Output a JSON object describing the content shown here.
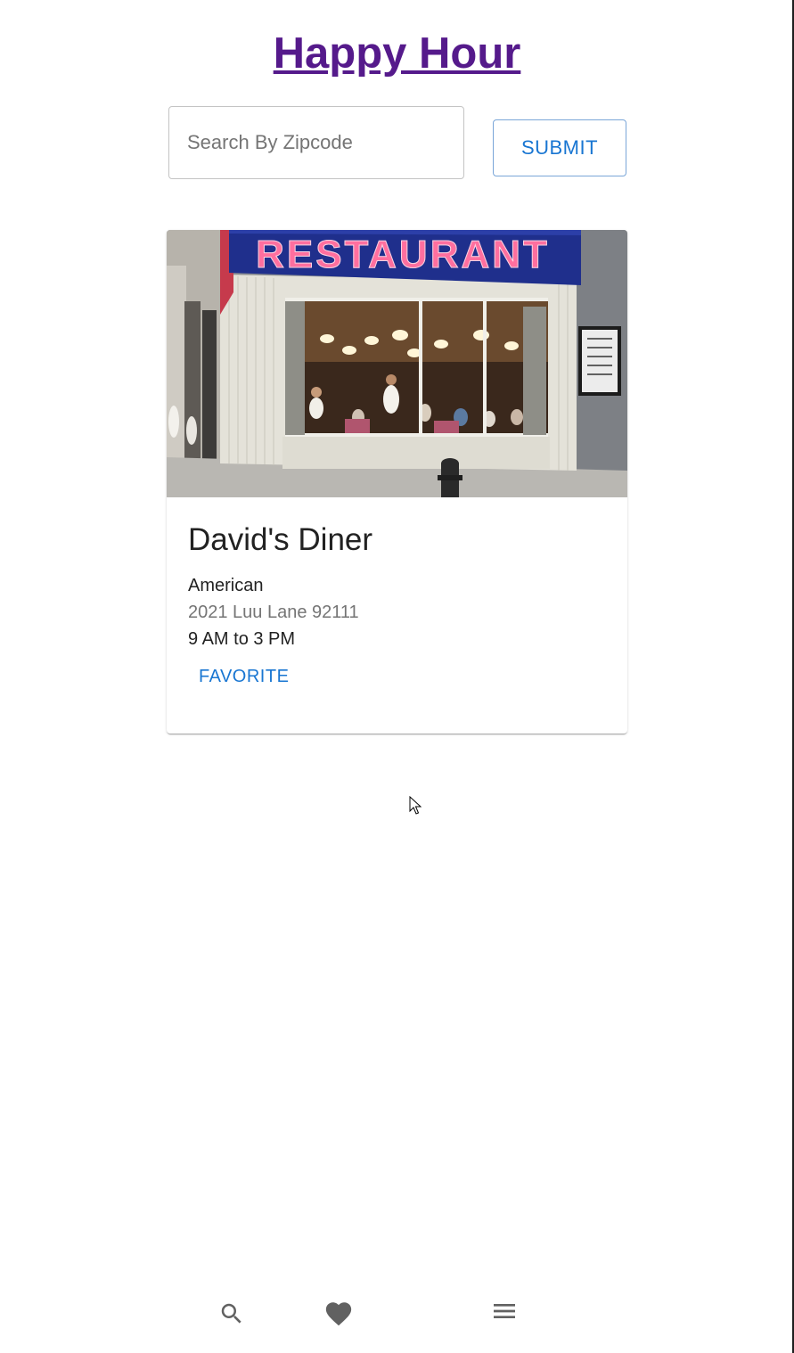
{
  "header": {
    "title": "Happy Hour"
  },
  "search": {
    "placeholder": "Search By Zipcode",
    "value": "",
    "submit_label": "SUBMIT"
  },
  "results": [
    {
      "image_sign_text": "RESTAURANT",
      "name": "David's Diner",
      "cuisine": "American",
      "address": "2021 Luu Lane 92111",
      "hours": "9 AM to 3 PM",
      "favorite_label": "FAVORITE"
    }
  ],
  "bottom_nav": {
    "items": [
      {
        "icon": "search-icon"
      },
      {
        "icon": "heart-icon"
      },
      {
        "icon": "menu-icon"
      }
    ]
  },
  "colors": {
    "title_link": "#551a8b",
    "primary": "#1976d2",
    "secondary_text": "#757575",
    "nav_icon": "#616161"
  }
}
